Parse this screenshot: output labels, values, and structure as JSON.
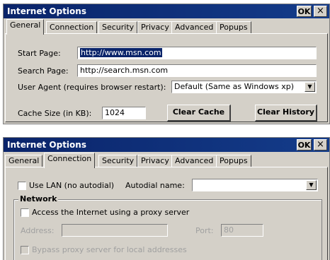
{
  "win1": {
    "title": "Internet Options",
    "ok_label": "OK",
    "close_label": "×",
    "tabs": [
      "General",
      "Connection",
      "Security",
      "Privacy",
      "Advanced",
      "Popups"
    ],
    "active_tab": "General",
    "start_page_label": "Start Page:",
    "start_page_value": "http://www.msn.com",
    "search_page_label": "Search Page:",
    "search_page_value": "http://search.msn.com",
    "user_agent_label": "User Agent (requires browser restart):",
    "user_agent_value": "Default (Same as Windows xp)",
    "cache_size_label": "Cache Size (in KB):",
    "cache_size_value": "1024",
    "clear_cache_label": "Clear Cache",
    "clear_history_label": "Clear History"
  },
  "win2": {
    "title": "Internet Options",
    "ok_label": "OK",
    "close_label": "×",
    "tabs": [
      "General",
      "Connection",
      "Security",
      "Privacy",
      "Advanced",
      "Popups"
    ],
    "active_tab": "Connection",
    "use_lan_label": "Use LAN (no autodial)",
    "autodial_label": "Autodial name:",
    "autodial_value": "",
    "network_group_label": "Network",
    "proxy_checkbox_label": "Access the Internet using a proxy server",
    "address_label": "Address:",
    "address_value": "",
    "port_label": "Port:",
    "port_value": "80",
    "bypass_label": "Bypass proxy server for local addresses"
  }
}
